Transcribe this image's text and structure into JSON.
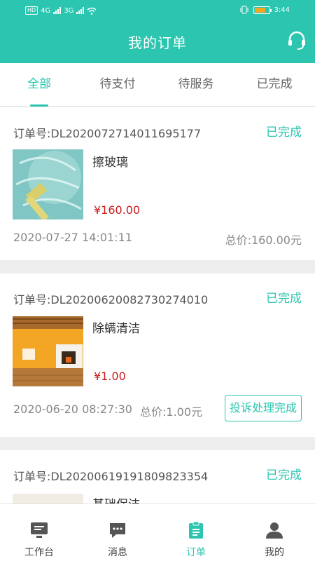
{
  "status_bar": {
    "hd": "HD",
    "net1": "4G",
    "net2": "3G",
    "battery": "77",
    "time": "3:44"
  },
  "header": {
    "title": "我的订单",
    "support_icon": "headset-icon"
  },
  "tabs": [
    {
      "label": "全部",
      "active": true
    },
    {
      "label": "待支付",
      "active": false
    },
    {
      "label": "待服务",
      "active": false
    },
    {
      "label": "已完成",
      "active": false
    }
  ],
  "orders": [
    {
      "order_no": "订单号:DL2020072714011695177",
      "status": "已完成",
      "service": "擦玻璃",
      "price": "¥160.00",
      "date": "2020-07-27 14:01:11",
      "total": "总价:160.00元"
    },
    {
      "order_no": "订单号:DL2020062008273027401​0",
      "status": "已完成",
      "service": "除螨清洁",
      "price": "¥1.00",
      "date": "2020-06-20 08:27:30",
      "total": "总价:1.00元",
      "action": "投诉处理完成"
    },
    {
      "order_no": "订单号:DL2020061919180982335​4",
      "status": "已完成",
      "service": "基础保洁"
    }
  ],
  "bottom_nav": [
    {
      "label": "工作台",
      "icon": "monitor-icon"
    },
    {
      "label": "消息",
      "icon": "chat-icon"
    },
    {
      "label": "订单",
      "icon": "clipboard-icon",
      "active": true
    },
    {
      "label": "我的",
      "icon": "user-icon"
    }
  ],
  "colors": {
    "accent": "#2cc5b0",
    "price": "#cc1b1b"
  }
}
